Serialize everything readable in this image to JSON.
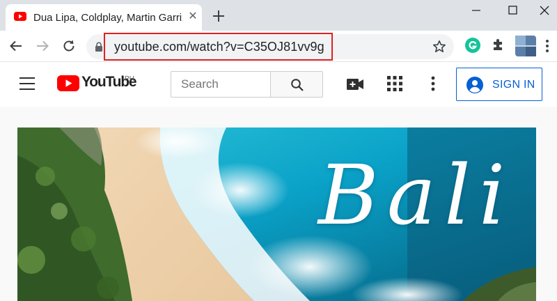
{
  "browser": {
    "tab": {
      "title": "Dua Lipa, Coldplay, Martin Garrix & Kygo, The Chainsmokers Style - Feeling Me",
      "favicon": "youtube-favicon-icon",
      "close_label": "✕"
    },
    "new_tab_label": "+",
    "window_controls": [
      "minimize-icon",
      "maximize-icon",
      "close-icon"
    ],
    "omnibox": {
      "url": "youtube.com/watch?v=C35OJ81vv9g",
      "highlight_color": "#e02020"
    },
    "extensions": [
      "grammarly-icon",
      "puzzle-extensions-icon",
      "profile-avatar-icon"
    ]
  },
  "youtube": {
    "logo_text": "YouTube",
    "country_code": "PH",
    "search": {
      "placeholder": "Search"
    },
    "sign_in_label": "SIGN IN",
    "brand_red": "#ff0000",
    "link_blue": "#065fd4"
  },
  "video": {
    "overlay_text": "Bali"
  }
}
